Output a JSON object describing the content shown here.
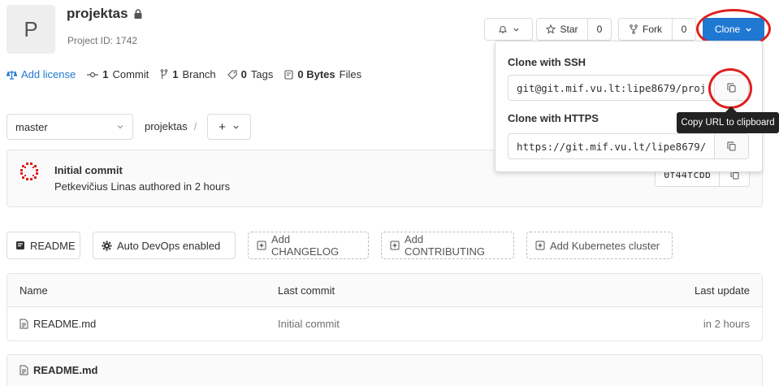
{
  "project": {
    "avatar_letter": "P",
    "name": "projektas",
    "id_text": "Project ID: 1742"
  },
  "header_buttons": {
    "star_label": "Star",
    "star_count": "0",
    "fork_label": "Fork",
    "fork_count": "0",
    "clone_label": "Clone"
  },
  "stats": {
    "add_license": "Add license",
    "commits_count": "1",
    "commits_label": "Commit",
    "branches_count": "1",
    "branches_label": "Branch",
    "tags_count": "0",
    "tags_label": "Tags",
    "files_size": "0 Bytes",
    "files_label": "Files"
  },
  "branch": {
    "selected": "master",
    "crumb": "projektas",
    "crumb_sep": "/",
    "plus": "+"
  },
  "last_commit": {
    "title": "Initial commit",
    "author_line": "Petkevičius Linas authored in 2 hours",
    "sha": "0f44fcbb"
  },
  "actions": {
    "readme": "README",
    "auto_devops": "Auto DevOps enabled",
    "add_changelog": "Add CHANGELOG",
    "add_contributing": "Add CONTRIBUTING",
    "add_kubernetes": "Add Kubernetes cluster"
  },
  "file_table": {
    "headers": {
      "name": "Name",
      "last_commit": "Last commit",
      "last_update": "Last update"
    },
    "rows": [
      {
        "name": "README.md",
        "last_commit": "Initial commit",
        "last_update": "in 2 hours"
      }
    ]
  },
  "readme_section": {
    "title": "README.md"
  },
  "clone_dropdown": {
    "ssh_label": "Clone with SSH",
    "ssh_url": "git@git.mif.vu.lt:lipe8679/proj",
    "https_label": "Clone with HTTPS",
    "https_url": "https://git.mif.vu.lt/lipe8679/",
    "tooltip": "Copy URL to clipboard"
  },
  "colors": {
    "primary": "#1f78d1",
    "annotation_red": "#e0201c"
  }
}
